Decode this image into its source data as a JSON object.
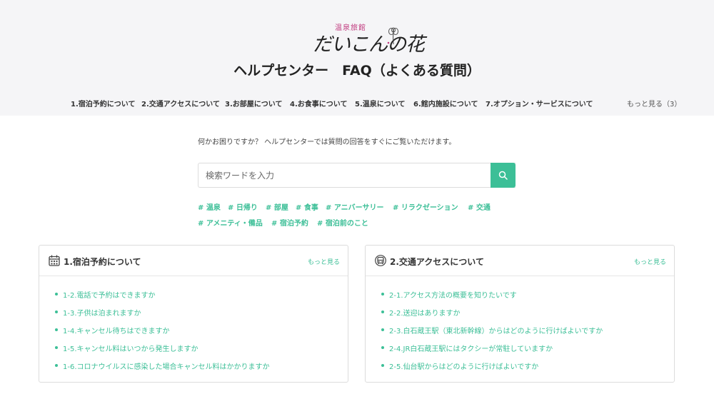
{
  "logo": {
    "small_text": "温泉旅館",
    "main_text": "だいこんの花"
  },
  "title": "ヘルプセンター　FAQ（よくある質問）",
  "nav": {
    "items": [
      "1.宿泊予約について",
      "2.交通アクセスについて",
      "3.お部屋について",
      "4.お食事について",
      "5.温泉について",
      "6.館内施設について",
      "7.オプション・サービスについて"
    ],
    "more": "もっと見る（3）"
  },
  "intro": "何かお困りですか？ ヘルプセンターでは質問の回答をすぐにご覧いただけます。",
  "search": {
    "placeholder": "検索ワードを入力",
    "value": ""
  },
  "tags": [
    "# 温泉",
    "# 日帰り",
    "# 部屋",
    "# 食事",
    "# アニバーサリー",
    "# リラクゼーション",
    "# 交通",
    "# アメニティ・備品",
    "# 宿泊予約",
    "# 宿泊前のこと"
  ],
  "cards": [
    {
      "title": "1.宿泊予約について",
      "more": "もっと見る",
      "icon": "calendar-icon",
      "items": [
        "1-2.電話で予約はできますか",
        "1-3.子供は泊まれますか",
        "1-4.キャンセル待ちはできますか",
        "1-5.キャンセル料はいつから発生しますか",
        "1-6.コロナウイルスに感染した場合キャンセル料はかかりますか"
      ]
    },
    {
      "title": "2.交通アクセスについて",
      "more": "もっと見る",
      "icon": "bus-icon",
      "items": [
        "2-1.アクセス方法の概要を知りたいです",
        "2-2.送迎はありますか",
        "2-3.白石蔵王駅（東北新幹線）からはどのように行けばよいですか",
        "2-4.JR白石蔵王駅にはタクシーが常駐していますか",
        "2-5.仙台駅からはどのように行けばよいですか"
      ]
    }
  ],
  "colors": {
    "accent": "#3cbf97",
    "header_bg": "#f5f5f7",
    "logo_pink": "#c0397e"
  }
}
